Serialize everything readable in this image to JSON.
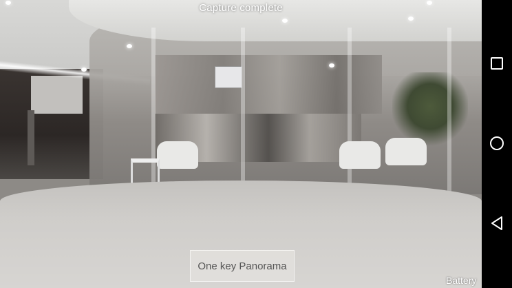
{
  "camera": {
    "status_text": "Capture complete",
    "panorama_button_label": "One key Panorama",
    "battery_label": "Battery"
  },
  "navigation_bar": {
    "buttons": [
      {
        "name": "recents",
        "icon": "square-icon"
      },
      {
        "name": "home",
        "icon": "circle-icon"
      },
      {
        "name": "back",
        "icon": "triangle-back-icon"
      }
    ],
    "icon_color": "#ffffff",
    "background": "#000000"
  }
}
